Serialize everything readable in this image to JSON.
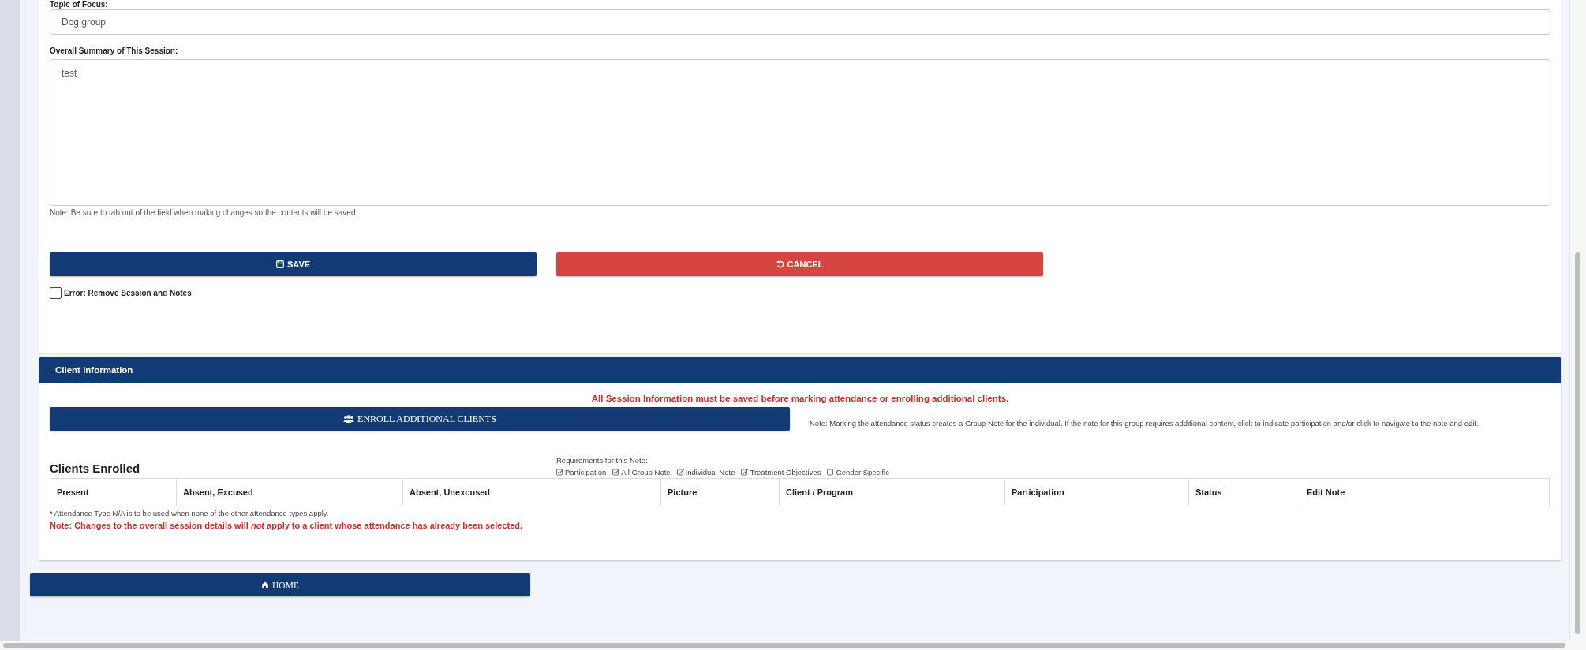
{
  "session": {
    "topic_label": "Topic of Focus:",
    "topic_value": "Dog group",
    "summary_label": "Overall Summary of This Session:",
    "summary_value": "test",
    "note": "Note: Be sure to tab out of the field when making changes so the contents will be saved.",
    "save": "SAVE",
    "cancel": "CANCEL",
    "error_checkbox": {
      "label": "Error: Remove Session and Notes",
      "checked": false
    }
  },
  "client_info": {
    "title": "Client Information",
    "expanded": true,
    "warning": "All Session Information must be saved before marking attendance or enrolling additional clients.",
    "enroll": "ENROLL ADDITIONAL CLIENTS",
    "enroll_note": "Note: Marking the attendance status creates a Group Note for the individual. If the note for this group requires additional content, click to indicate participation and/or click to navigate to the note and edit.",
    "heading": "Clients Enrolled",
    "requirements_label": "Requirements for this Note:",
    "requirements": [
      {
        "label": "Participation",
        "checked": true
      },
      {
        "label": "All Group Note",
        "checked": true
      },
      {
        "label": "Individual Note",
        "checked": true
      },
      {
        "label": "Treatment Objectives",
        "checked": true
      },
      {
        "label": "Gender Specific",
        "checked": false
      }
    ],
    "table": {
      "columns": [
        "Present",
        "Absent, Excused",
        "Absent, Unexcused",
        "Picture",
        "Client / Program",
        "Participation",
        "Status",
        "Edit Note"
      ]
    },
    "footnote": "* Attendance Type N/A is to be used when none of the other attendance types apply.",
    "change_note": "Note: Changes to the overall session details will *not* apply to a client whose attendance has already been selected."
  },
  "home": "HOME"
}
